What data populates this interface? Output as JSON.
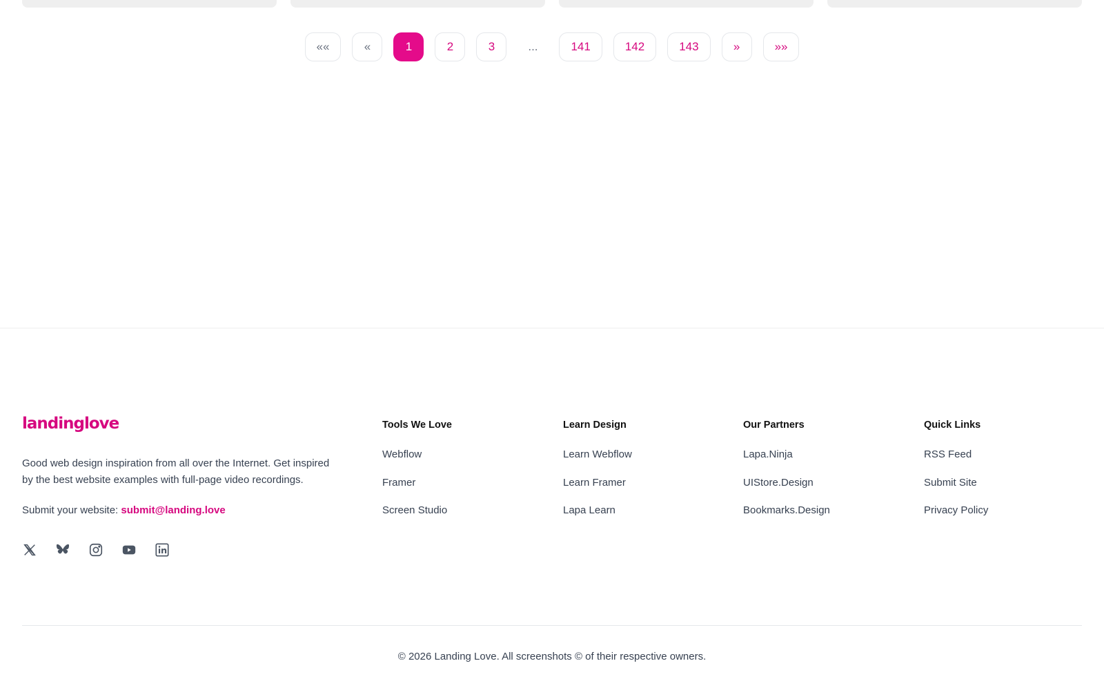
{
  "pagination": {
    "first": "««",
    "prev": "«",
    "pages": [
      "1",
      "2",
      "3"
    ],
    "ellipsis": "...",
    "last_pages": [
      "141",
      "142",
      "143"
    ],
    "next": "»",
    "last": "»»",
    "current": "1"
  },
  "footer": {
    "brand": "landinglove",
    "about": "Good web design inspiration from all over the Internet. Get inspired by the best website examples with full-page video recordings.",
    "submit_label": "Submit your website: ",
    "submit_email": "submit@landing.love",
    "socials": [
      "x-icon",
      "bluesky-icon",
      "instagram-icon",
      "youtube-icon",
      "linkedin-icon"
    ],
    "columns": [
      {
        "title": "Tools We Love",
        "links": [
          "Webflow",
          "Framer",
          "Screen Studio"
        ]
      },
      {
        "title": "Learn Design",
        "links": [
          "Learn Webflow",
          "Learn Framer",
          "Lapa Learn"
        ]
      },
      {
        "title": "Our Partners",
        "links": [
          "Lapa.Ninja",
          "UIStore.Design",
          "Bookmarks.Design"
        ]
      },
      {
        "title": "Quick Links",
        "links": [
          "RSS Feed",
          "Submit Site",
          "Privacy Policy"
        ]
      }
    ],
    "copyright": "© 2026 Landing Love. All screenshots © of their respective owners."
  },
  "colors": {
    "accent": "#e40b8a",
    "link": "#d6087f",
    "text": "#374151",
    "heading": "#111111"
  }
}
